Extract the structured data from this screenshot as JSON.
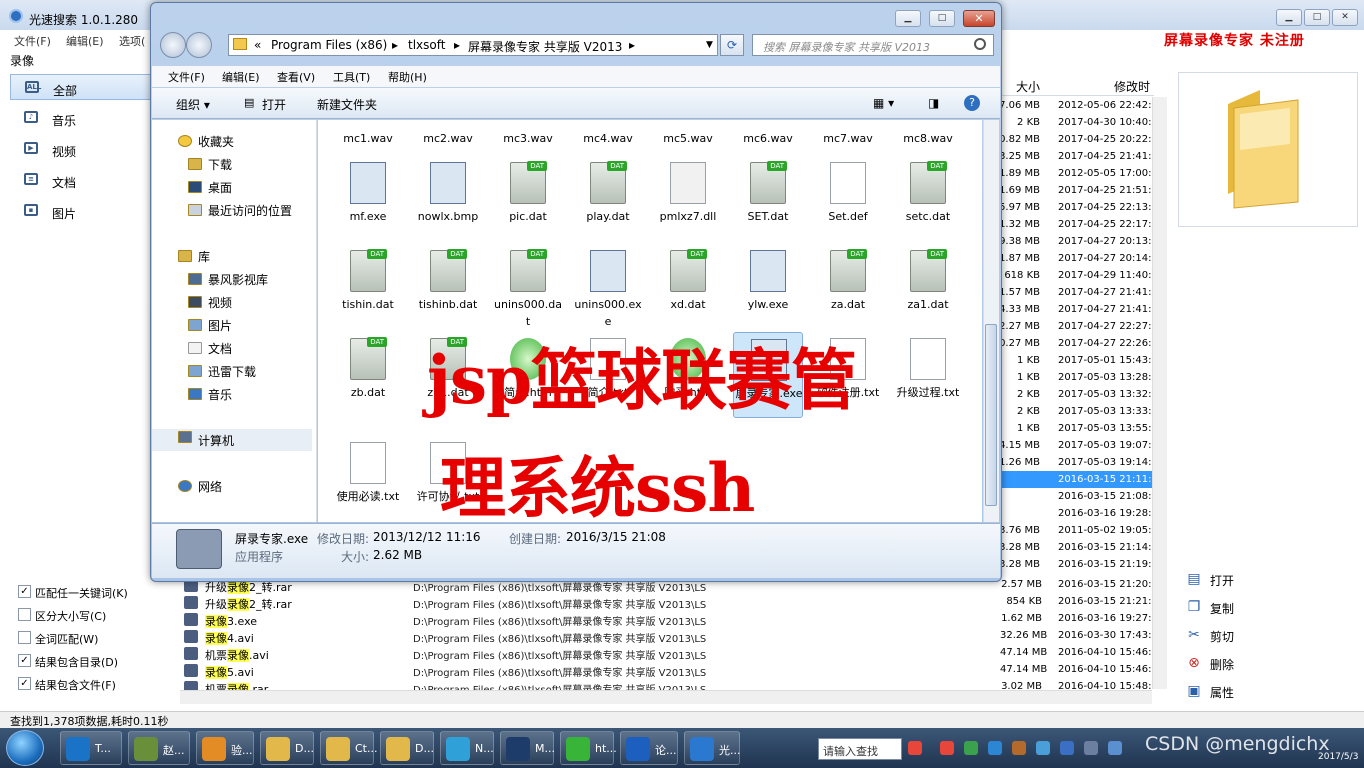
{
  "back_app": {
    "title": "光速搜索 1.0.1.280",
    "menu": [
      "文件(F)",
      "编辑(E)",
      "选项("
    ],
    "brand": "屏幕录像专家  未注册",
    "search_label": "录像",
    "categories": [
      {
        "label": "全部",
        "icon": "all-icon",
        "selected": true
      },
      {
        "label": "音乐",
        "icon": "music-icon"
      },
      {
        "label": "视频",
        "icon": "video-icon"
      },
      {
        "label": "文档",
        "icon": "document-icon"
      },
      {
        "label": "图片",
        "icon": "picture-icon"
      }
    ],
    "options": [
      {
        "label": "匹配任一关键词(K)",
        "checked": true
      },
      {
        "label": "区分大小写(C)",
        "checked": false
      },
      {
        "label": "全词匹配(W)",
        "checked": false
      },
      {
        "label": "结果包含目录(D)",
        "checked": true
      },
      {
        "label": "结果包含文件(F)",
        "checked": true
      }
    ],
    "columns": {
      "size": "大小",
      "modified": "修改时"
    },
    "size_rows": [
      {
        "size": "7.06 MB",
        "date": "2012-05-06 22:42:"
      },
      {
        "size": "2 KB",
        "date": "2017-04-30 10:40:"
      },
      {
        "size": "0.82 MB",
        "date": "2017-04-25 20:22:"
      },
      {
        "size": "3.25 MB",
        "date": "2017-04-25 21:41:5"
      },
      {
        "size": "1.89 MB",
        "date": "2012-05-05 17:00:"
      },
      {
        "size": "1.69 MB",
        "date": "2017-04-25 21:51:5"
      },
      {
        "size": "5.97 MB",
        "date": "2017-04-25 22:13:"
      },
      {
        "size": "1.32 MB",
        "date": "2017-04-25 22:17:2"
      },
      {
        "size": "9.38 MB",
        "date": "2017-04-27 20:13:5"
      },
      {
        "size": "1.87 MB",
        "date": "2017-04-27 20:14:3"
      },
      {
        "size": "618 KB",
        "date": "2017-04-29 11:40:0"
      },
      {
        "size": "1.57 MB",
        "date": "2017-04-27 21:41:"
      },
      {
        "size": "4.33 MB",
        "date": "2017-04-27 21:41:"
      },
      {
        "size": "2.27 MB",
        "date": "2017-04-27 22:27:0"
      },
      {
        "size": "0.27 MB",
        "date": "2017-04-27 22:26:0"
      },
      {
        "size": "1 KB",
        "date": "2017-05-01 15:43:5"
      },
      {
        "size": "1 KB",
        "date": "2017-05-03 13:28:3"
      },
      {
        "size": "2 KB",
        "date": "2017-05-03 13:32:"
      },
      {
        "size": "2 KB",
        "date": "2017-05-03 13:33:0"
      },
      {
        "size": "1 KB",
        "date": "2017-05-03 13:55:"
      },
      {
        "size": "4.15 MB",
        "date": "2017-05-03 19:07:0"
      },
      {
        "size": "1.26 MB",
        "date": "2017-05-03 19:14:7"
      },
      {
        "size": "",
        "date": "2016-03-15 21:11:",
        "selected": true
      },
      {
        "size": "",
        "date": "2016-03-15 21:08:3"
      },
      {
        "size": "",
        "date": "2016-03-16 19:28:"
      },
      {
        "size": "3.76 MB",
        "date": "2011-05-02 19:05:"
      },
      {
        "size": "3.28 MB",
        "date": "2016-03-15 21:14:"
      },
      {
        "size": "3.28 MB",
        "date": "2016-03-15 21:19:"
      }
    ],
    "results": [
      {
        "pre": "升级",
        "hl": "录像",
        "post": "2_转.rar",
        "path": "D:\\Program Files (x86)\\tlxsoft\\屏幕录像专家 共享版 V2013\\LS",
        "size": "2.57 MB",
        "date": "2016-03-15 21:20:"
      },
      {
        "pre": "升级",
        "hl": "录像",
        "post": "2_转.rar",
        "path": "D:\\Program Files (x86)\\tlxsoft\\屏幕录像专家 共享版 V2013\\LS",
        "size": "854 KB",
        "date": "2016-03-15 21:21:"
      },
      {
        "pre": "",
        "hl": "录像",
        "post": "3.exe",
        "path": "D:\\Program Files (x86)\\tlxsoft\\屏幕录像专家 共享版 V2013\\LS",
        "size": "1.62 MB",
        "date": "2016-03-16 19:27:"
      },
      {
        "pre": "",
        "hl": "录像",
        "post": "4.avi",
        "path": "D:\\Program Files (x86)\\tlxsoft\\屏幕录像专家 共享版 V2013\\LS",
        "size": "32.26 MB",
        "date": "2016-03-30 17:43:"
      },
      {
        "pre": "机票",
        "hl": "录像",
        "post": ".avi",
        "path": "D:\\Program Files (x86)\\tlxsoft\\屏幕录像专家 共享版 V2013\\LS",
        "size": "47.14 MB",
        "date": "2016-04-10 15:46:"
      },
      {
        "pre": "",
        "hl": "录像",
        "post": "5.avi",
        "path": "D:\\Program Files (x86)\\tlxsoft\\屏幕录像专家 共享版 V2013\\LS",
        "size": "47.14 MB",
        "date": "2016-04-10 15:46:"
      },
      {
        "pre": "机票",
        "hl": "录像",
        "post": ".rar",
        "path": "D:\\Program Files (x86)\\tlxsoft\\屏幕录像专家 共享版 V2013\\LS",
        "size": "3.02 MB",
        "date": "2016-04-10 15:48:"
      }
    ],
    "actions": [
      {
        "label": "打开",
        "icon": "open-icon"
      },
      {
        "label": "复制",
        "icon": "copy-icon"
      },
      {
        "label": "剪切",
        "icon": "scissors-icon"
      },
      {
        "label": "删除",
        "icon": "delete-icon"
      },
      {
        "label": "属性",
        "icon": "properties-icon"
      }
    ],
    "status": "查找到1,378项数据,耗时0.11秒"
  },
  "explorer": {
    "breadcrumbs": [
      "«",
      "Program Files (x86)",
      "▸",
      "tlxsoft",
      "▸",
      "屏幕录像专家 共享版 V2013",
      "▸"
    ],
    "search_placeholder": "搜索 屏幕录像专家 共享版 V2013",
    "menu": [
      "文件(F)",
      "编辑(E)",
      "查看(V)",
      "工具(T)",
      "帮助(H)"
    ],
    "toolbar": {
      "organize": "组织 ▾",
      "open": "打开",
      "new_folder": "新建文件夹"
    },
    "nav": {
      "favorites": "收藏夹",
      "fav_items": [
        "下载",
        "桌面",
        "最近访问的位置"
      ],
      "library": "库",
      "lib_items": [
        "暴风影视库",
        "视频",
        "图片",
        "文档",
        "迅雷下载",
        "音乐"
      ],
      "computer": "计算机",
      "network": "网络"
    },
    "top_row": [
      "mc1.wav",
      "mc2.wav",
      "mc3.wav",
      "mc4.wav",
      "mc5.wav",
      "mc6.wav",
      "mc7.wav",
      "mc8.wav"
    ],
    "files": [
      {
        "name": "mf.exe",
        "type": "app"
      },
      {
        "name": "nowlx.bmp",
        "type": "app"
      },
      {
        "name": "pic.dat",
        "type": "dat"
      },
      {
        "name": "play.dat",
        "type": "dat"
      },
      {
        "name": "pmlxz7.dll",
        "type": "gear"
      },
      {
        "name": "SET.dat",
        "type": "dat"
      },
      {
        "name": "Set.def",
        "type": "doc"
      },
      {
        "name": "setc.dat",
        "type": "dat"
      },
      {
        "name": "tishin.dat",
        "type": "dat"
      },
      {
        "name": "tishinb.dat",
        "type": "dat"
      },
      {
        "name": "unins000.dat",
        "type": "dat"
      },
      {
        "name": "unins000.exe",
        "type": "app"
      },
      {
        "name": "xd.dat",
        "type": "dat"
      },
      {
        "name": "ylw.exe",
        "type": "app"
      },
      {
        "name": "za.dat",
        "type": "dat"
      },
      {
        "name": "za1.dat",
        "type": "dat"
      },
      {
        "name": "zb.dat",
        "type": "dat"
      },
      {
        "name": "zb1.dat",
        "type": "dat"
      },
      {
        "name": "简介.htm",
        "type": "ie"
      },
      {
        "name": "简介.txt",
        "type": "doc"
      },
      {
        "name": "购买.htm",
        "type": "ie"
      },
      {
        "name": "屏录专家.exe",
        "type": "app",
        "selected": true
      },
      {
        "name": "软件注册.txt",
        "type": "doc"
      },
      {
        "name": "升级过程.txt",
        "type": "doc"
      },
      {
        "name": "使用必读.txt",
        "type": "doc"
      },
      {
        "name": "许可协议.txt",
        "type": "doc"
      }
    ],
    "details": {
      "filename": "屏录专家.exe",
      "modified_label": "修改日期:",
      "modified": "2013/12/12 11:16",
      "created_label": "创建日期:",
      "created": "2016/3/15 21:08",
      "kind": "应用程序",
      "size_label": "大小:",
      "size": "2.62 MB"
    }
  },
  "watermark": {
    "line1": "jsp篮球联赛管",
    "line2": "理系统ssh"
  },
  "taskbar": {
    "tasks": [
      {
        "label": "T...",
        "color": "#1a73c7"
      },
      {
        "label": "赵...",
        "color": "#6a8f3a"
      },
      {
        "label": "验...",
        "color": "#e38b24"
      },
      {
        "label": "D...",
        "color": "#e2b84a"
      },
      {
        "label": "Ct...",
        "color": "#e2b84a"
      },
      {
        "label": "D...",
        "color": "#e2b84a"
      },
      {
        "label": "N...",
        "color": "#2fa0d8"
      },
      {
        "label": "M...",
        "color": "#1d3c6a"
      },
      {
        "label": "ht...",
        "color": "#38b438"
      },
      {
        "label": "论...",
        "color": "#1c5fbf"
      },
      {
        "label": "光...",
        "color": "#2a78d0"
      }
    ],
    "search": "请输入查找",
    "csdn": "CSDN @mengdichx",
    "date": "2017/5/3"
  }
}
